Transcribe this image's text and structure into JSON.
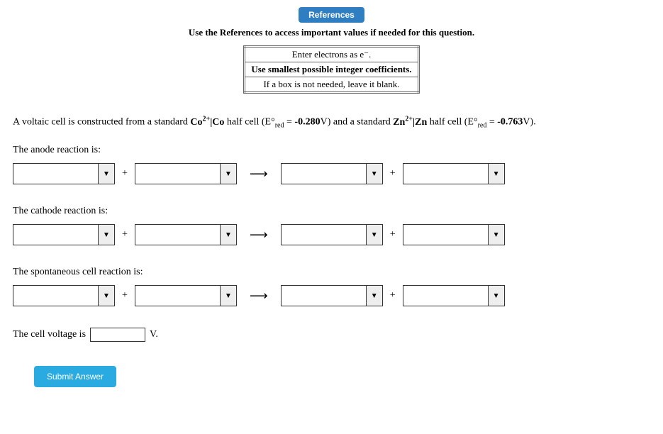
{
  "header": {
    "references_button": "References",
    "subtitle": "Use the References to access important values if needed for this question."
  },
  "instructions": {
    "row1": "Enter electrons as e⁻.",
    "row2": "Use smallest possible integer coefficients.",
    "row3": "If a box is not needed, leave it blank."
  },
  "question": {
    "prefix": "A voltaic cell is constructed from a standard ",
    "species1_base": "Co",
    "species1_sup": "2+",
    "sep1": "|",
    "species1_metal": "Co",
    "half1_label": " half cell (E°",
    "sub_red": "red",
    "half1_value": " = -0.280V) and a standard ",
    "species2_base": "Zn",
    "species2_sup": "2+",
    "sep2": "|",
    "species2_metal": "Zn",
    "half2_label": " half cell (E°",
    "half2_value": " = -0.763V)."
  },
  "labels": {
    "anode": "The anode reaction is:",
    "cathode": "The cathode reaction is:",
    "spontaneous": "The spontaneous cell reaction is:",
    "voltage_prefix": "The cell voltage is",
    "voltage_unit": "V."
  },
  "symbols": {
    "plus": "+",
    "arrow": "⟶",
    "dropdown": "▼"
  },
  "buttons": {
    "submit": "Submit Answer"
  }
}
